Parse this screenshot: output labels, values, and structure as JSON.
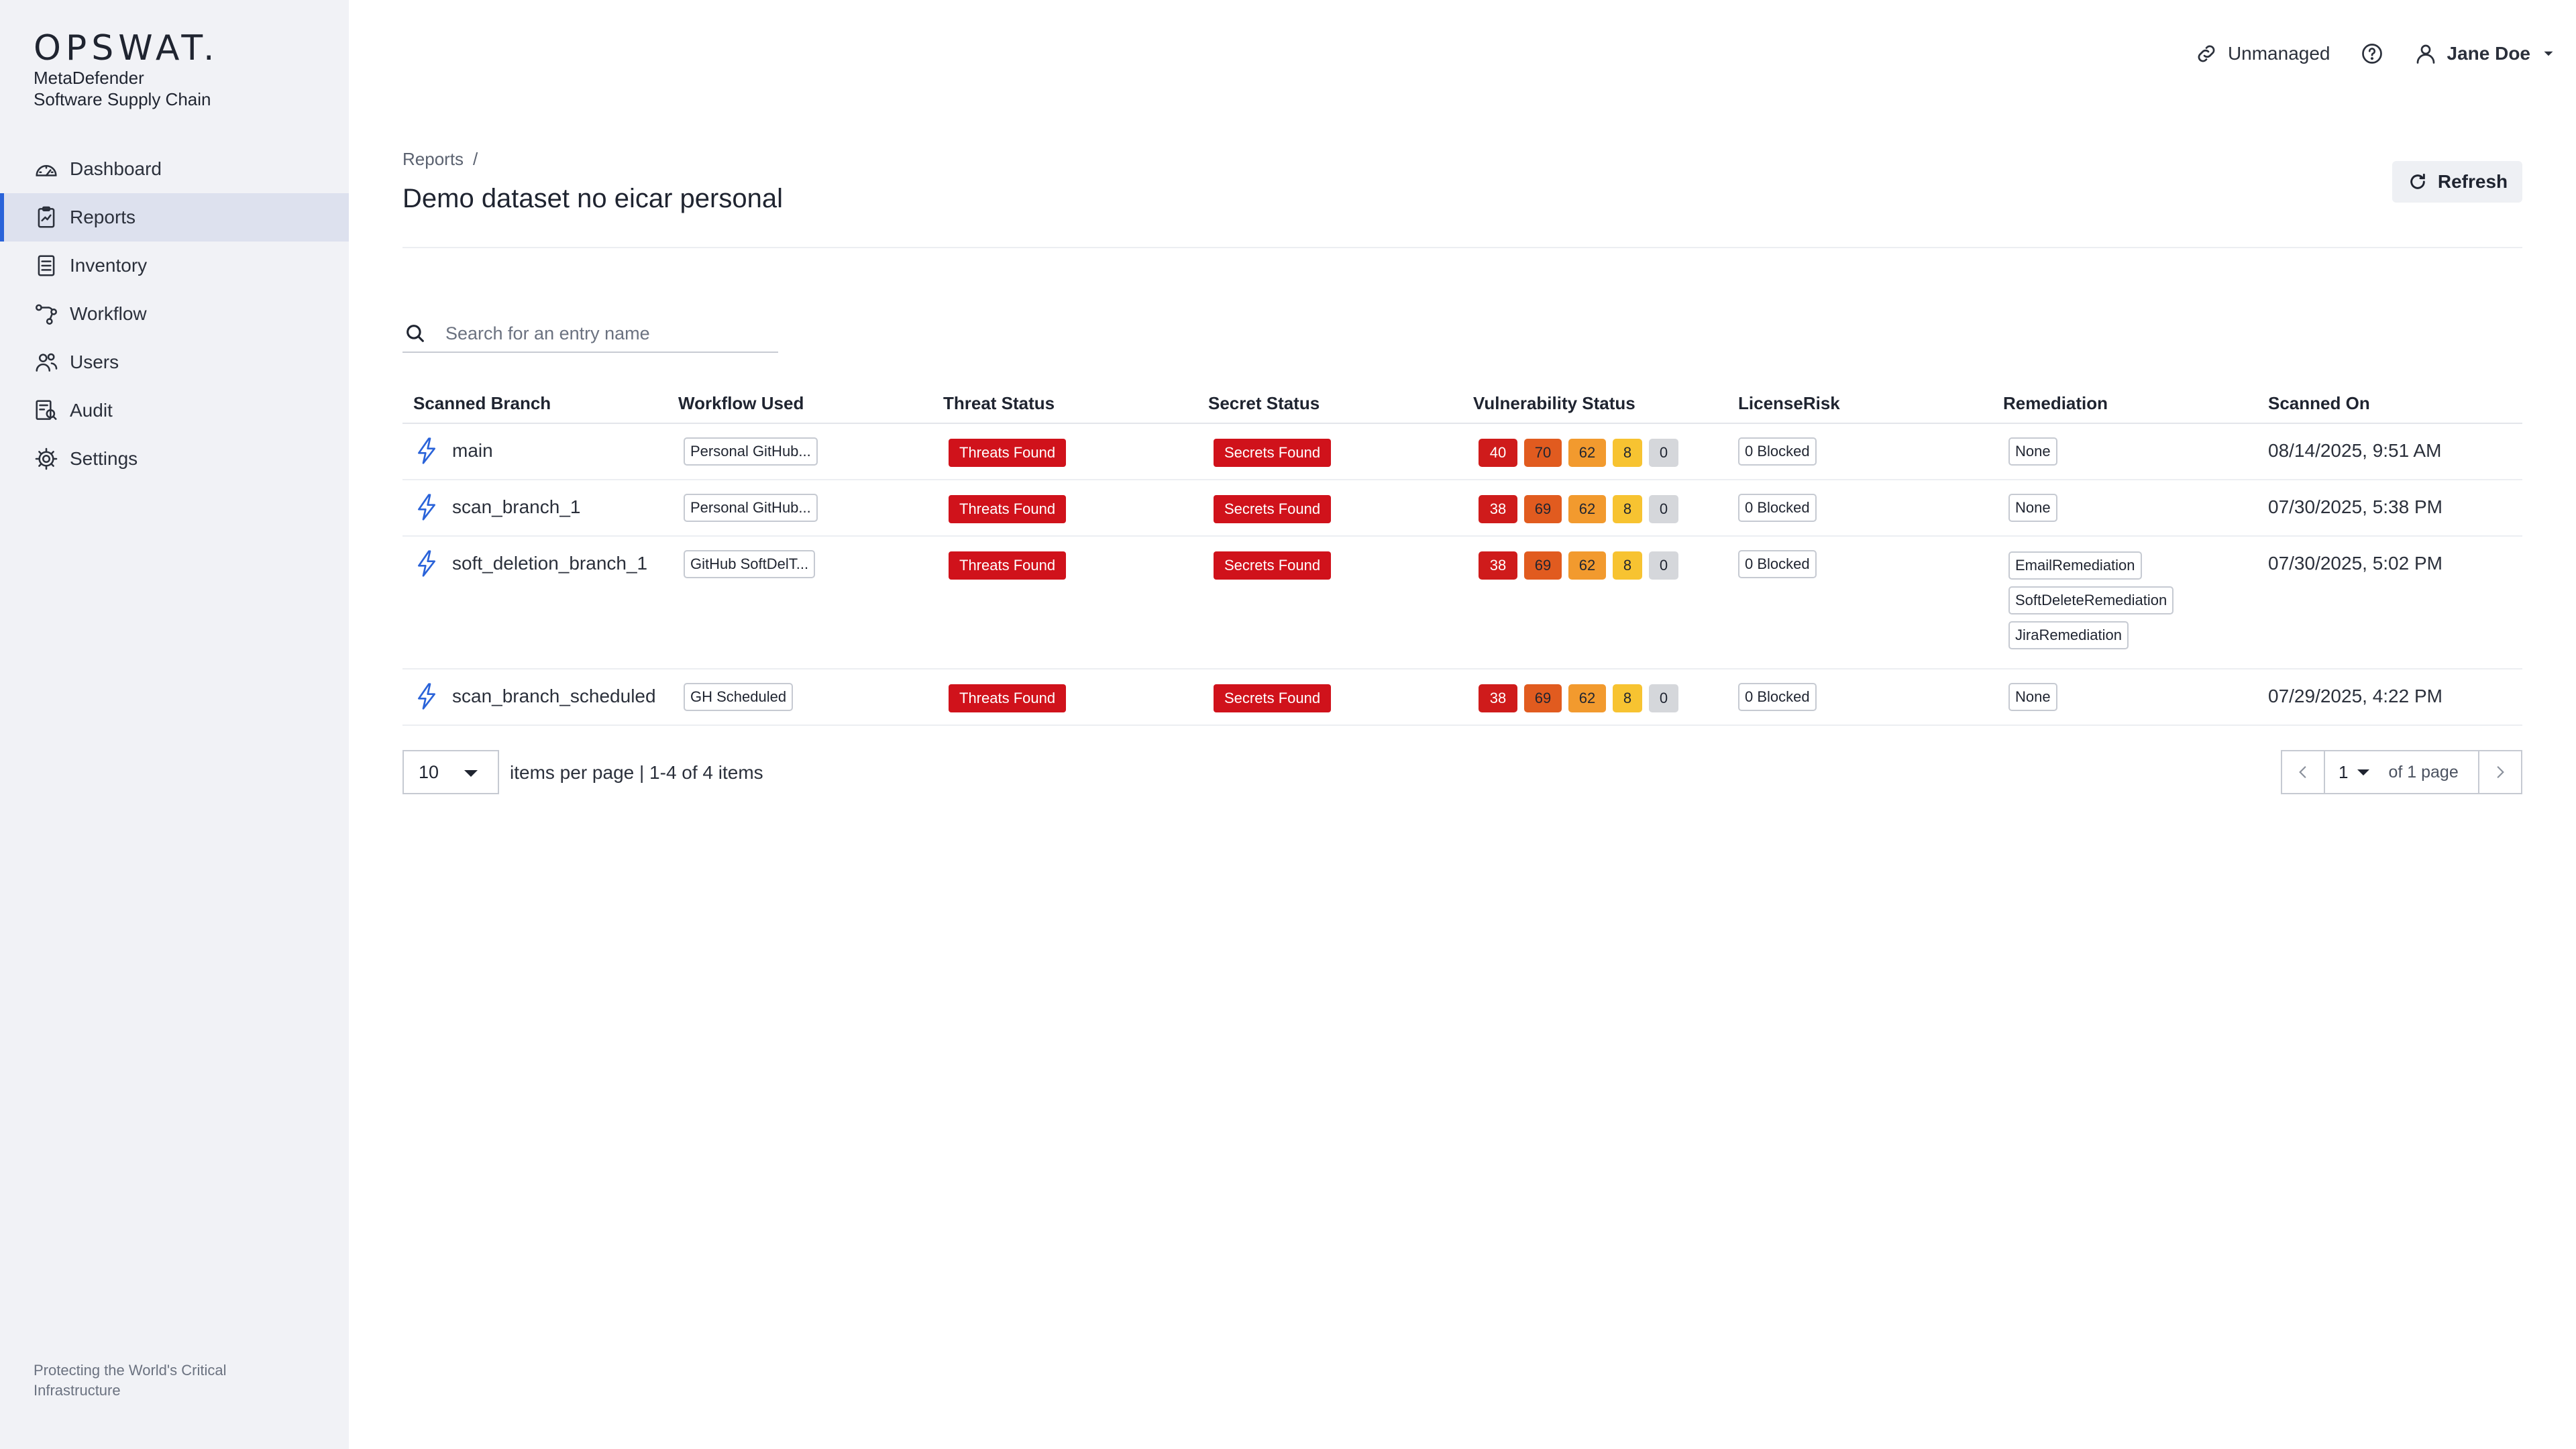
{
  "brand": {
    "logo": "OPSWAT.",
    "product_line1": "MetaDefender",
    "product_line2": "Software Supply Chain",
    "footer": "Protecting the World's Critical Infrastructure"
  },
  "nav": {
    "items": [
      {
        "label": "Dashboard",
        "icon": "dashboard-gauge-icon",
        "active": false
      },
      {
        "label": "Reports",
        "icon": "clipboard-report-icon",
        "active": true
      },
      {
        "label": "Inventory",
        "icon": "clipboard-list-icon",
        "active": false
      },
      {
        "label": "Workflow",
        "icon": "workflow-icon",
        "active": false
      },
      {
        "label": "Users",
        "icon": "users-icon",
        "active": false
      },
      {
        "label": "Audit",
        "icon": "audit-icon",
        "active": false
      },
      {
        "label": "Settings",
        "icon": "gear-icon",
        "active": false
      }
    ]
  },
  "topbar": {
    "unmanaged_label": "Unmanaged",
    "user_name": "Jane Doe"
  },
  "header": {
    "breadcrumb_root": "Reports",
    "breadcrumb_sep": "/",
    "title": "Demo dataset no eicar personal",
    "refresh_label": "Refresh"
  },
  "search": {
    "placeholder": "Search for an entry name",
    "value": ""
  },
  "table": {
    "columns": [
      "Scanned Branch",
      "Workflow Used",
      "Threat Status",
      "Secret Status",
      "Vulnerability Status",
      "LicenseRisk",
      "Remediation",
      "Scanned On"
    ],
    "rows": [
      {
        "branch": "main",
        "workflow": "Personal GitHub...",
        "threat": "Threats Found",
        "secret": "Secrets Found",
        "vuln": {
          "critical": "40",
          "high": "70",
          "medium": "62",
          "low": "8",
          "none": "0"
        },
        "license": "0 Blocked",
        "remediation": [
          "None"
        ],
        "scanned_on": "08/14/2025, 9:51 AM"
      },
      {
        "branch": "scan_branch_1",
        "workflow": "Personal GitHub...",
        "threat": "Threats Found",
        "secret": "Secrets Found",
        "vuln": {
          "critical": "38",
          "high": "69",
          "medium": "62",
          "low": "8",
          "none": "0"
        },
        "license": "0 Blocked",
        "remediation": [
          "None"
        ],
        "scanned_on": "07/30/2025, 5:38 PM"
      },
      {
        "branch": "soft_deletion_branch_1",
        "workflow": "GitHub SoftDelT...",
        "threat": "Threats Found",
        "secret": "Secrets Found",
        "vuln": {
          "critical": "38",
          "high": "69",
          "medium": "62",
          "low": "8",
          "none": "0"
        },
        "license": "0 Blocked",
        "remediation": [
          "EmailRemediation",
          "SoftDeleteRemediation",
          "JiraRemediation"
        ],
        "scanned_on": "07/30/2025, 5:02 PM"
      },
      {
        "branch": "scan_branch_scheduled",
        "workflow": "GH Scheduled",
        "threat": "Threats Found",
        "secret": "Secrets Found",
        "vuln": {
          "critical": "38",
          "high": "69",
          "medium": "62",
          "low": "8",
          "none": "0"
        },
        "license": "0 Blocked",
        "remediation": [
          "None"
        ],
        "scanned_on": "07/29/2025, 4:22 PM"
      }
    ]
  },
  "pagination": {
    "per_page": "10",
    "summary": "items per page | 1-4 of 4 items",
    "current_page": "1",
    "of_pages": "of 1 page"
  },
  "colors": {
    "accent": "#2a63d9",
    "danger": "#d0121b",
    "vuln_critical": "#cf1b1b",
    "vuln_high": "#e15b1f",
    "vuln_medium": "#f29a2e",
    "vuln_low": "#f7c331",
    "vuln_none": "#d5d7db",
    "sidebar_bg": "#f1f2f6"
  }
}
